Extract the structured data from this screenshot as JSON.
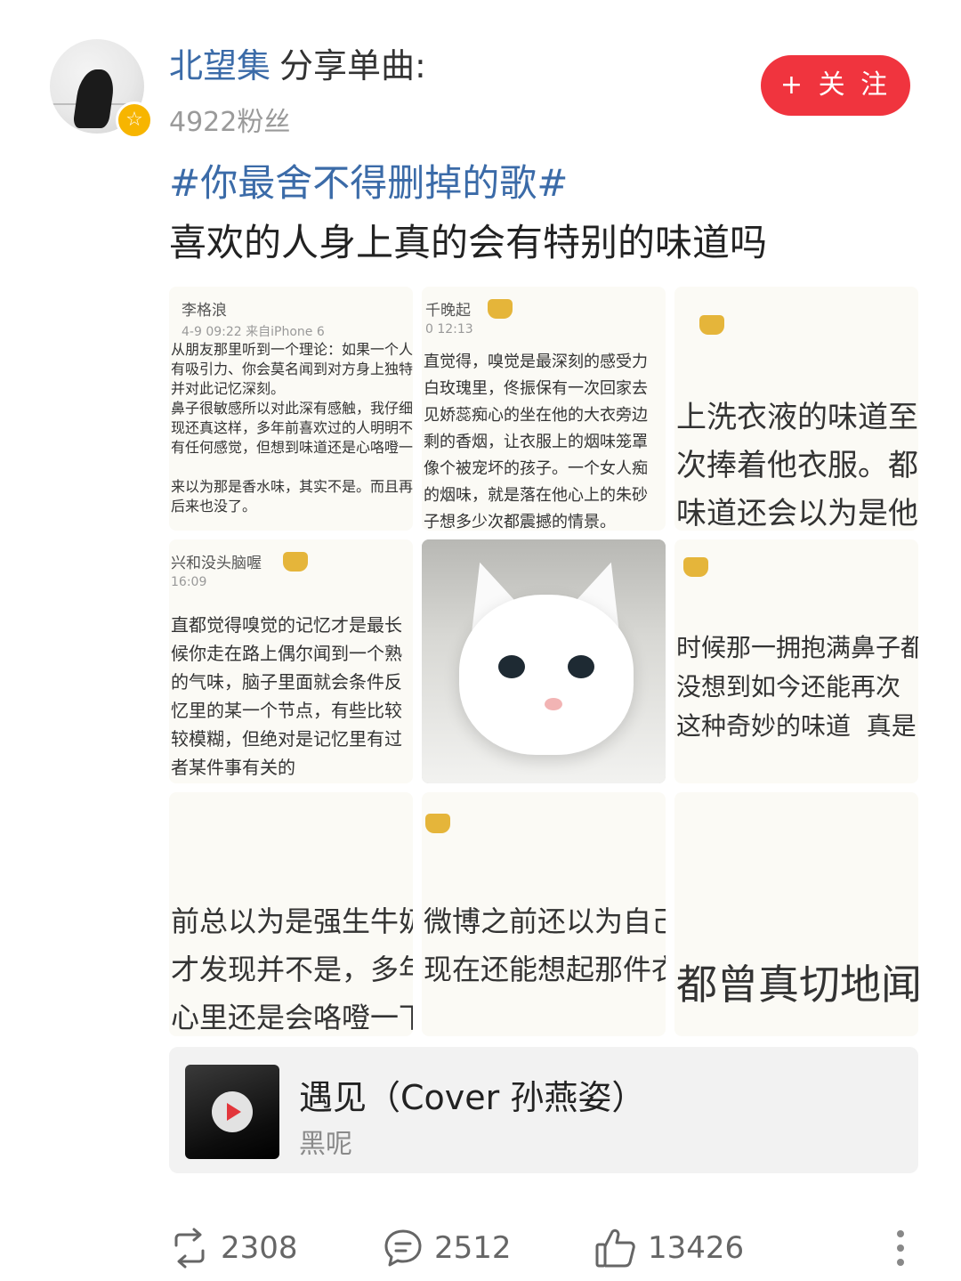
{
  "header": {
    "username": "北望集",
    "share_label": "分享单曲:",
    "fans": "4922粉丝",
    "follow_label": "+ 关 注"
  },
  "post": {
    "hashtag": "#你最舍不得删掉的歌#",
    "text": "喜欢的人身上真的会有特别的味道吗"
  },
  "images": {
    "img1": {
      "name": "李格浪",
      "meta": "4-9 09:22  来自iPhone 6",
      "body": "从朋友那里听到一个理论：如果一个人\n有吸引力、你会莫名闻到对方身上独特\n并对此记忆深刻。\n鼻子很敏感所以对此深有感触，我仔细\n现还真这样，多年前喜欢过的人明明不\n有任何感觉，但想到味道还是心咯噔一\n\n来以为那是香水味，其实不是。而且再\n后来也没了。"
    },
    "img2": {
      "name": "千晚起",
      "meta": "0 12:13",
      "body": "直觉得，嗅觉是最深刻的感受力\n白玫瑰里，佟振保有一次回家去\n见娇蕊痴心的坐在他的大衣旁边\n剩的香烟，让衣服上的烟味笼罩\n像个被宠坏的孩子。一个女人痴\n的烟味，就是落在他心上的朱砂\n子想多少次都震撼的情景。"
    },
    "img3": {
      "body": "上洗衣液的味道至\n次捧着他衣服。都\n味道还会以为是他"
    },
    "img4": {
      "name": "兴和没头脑喔",
      "meta": "16:09",
      "body": "直都觉得嗅觉的记忆才是最长\n候你走在路上偶尔闻到一个熟\n的气味，脑子里面就会条件反\n忆里的某一个节点，有些比较\n较模糊，但绝对是记忆里有过\n者某件事有关的"
    },
    "img6": {
      "body": "时候那一拥抱满鼻子都\n没想到如今还能再次\n这种奇妙的味道  真是"
    },
    "img7": {
      "body": "前总以为是强生牛奶\n才发现并不是，多年\n心里还是会咯噔一下"
    },
    "img8": {
      "body": "微博之前还以为自己\n现在还能想起那件衣"
    },
    "img9": {
      "body": "都曾真切地闻"
    }
  },
  "music": {
    "title": "遇见（Cover 孙燕姿）",
    "artist": "黑呢"
  },
  "stats": {
    "reposts": "2308",
    "comments": "2512",
    "likes": "13426"
  },
  "colors": {
    "link_blue": "#3b6ba8",
    "follow_red": "#f0343e",
    "badge_gold": "#f7b500"
  }
}
